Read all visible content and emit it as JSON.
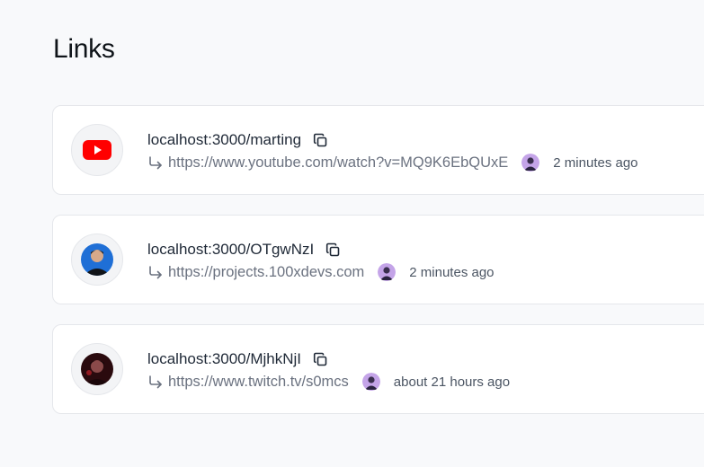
{
  "page": {
    "title": "Links"
  },
  "links": [
    {
      "short_url": "localhost:3000/marting",
      "destination": "https://www.youtube.com/watch?v=MQ9K6EbQUxE",
      "time": "2 minutes ago",
      "favicon": "youtube-icon"
    },
    {
      "short_url": "localhost:3000/OTgwNzI",
      "destination": "https://projects.100xdevs.com",
      "time": "2 minutes ago",
      "favicon": "profile-avatar-icon"
    },
    {
      "short_url": "localhost:3000/MjhkNjI",
      "destination": "https://www.twitch.tv/s0mcs",
      "time": "about 21 hours ago",
      "favicon": "profile-avatar-icon"
    }
  ],
  "colors": {
    "youtube_red": "#ff0000",
    "background": "#f8f9fb",
    "card_border": "#e5e7eb",
    "muted_text": "#6b7280"
  }
}
